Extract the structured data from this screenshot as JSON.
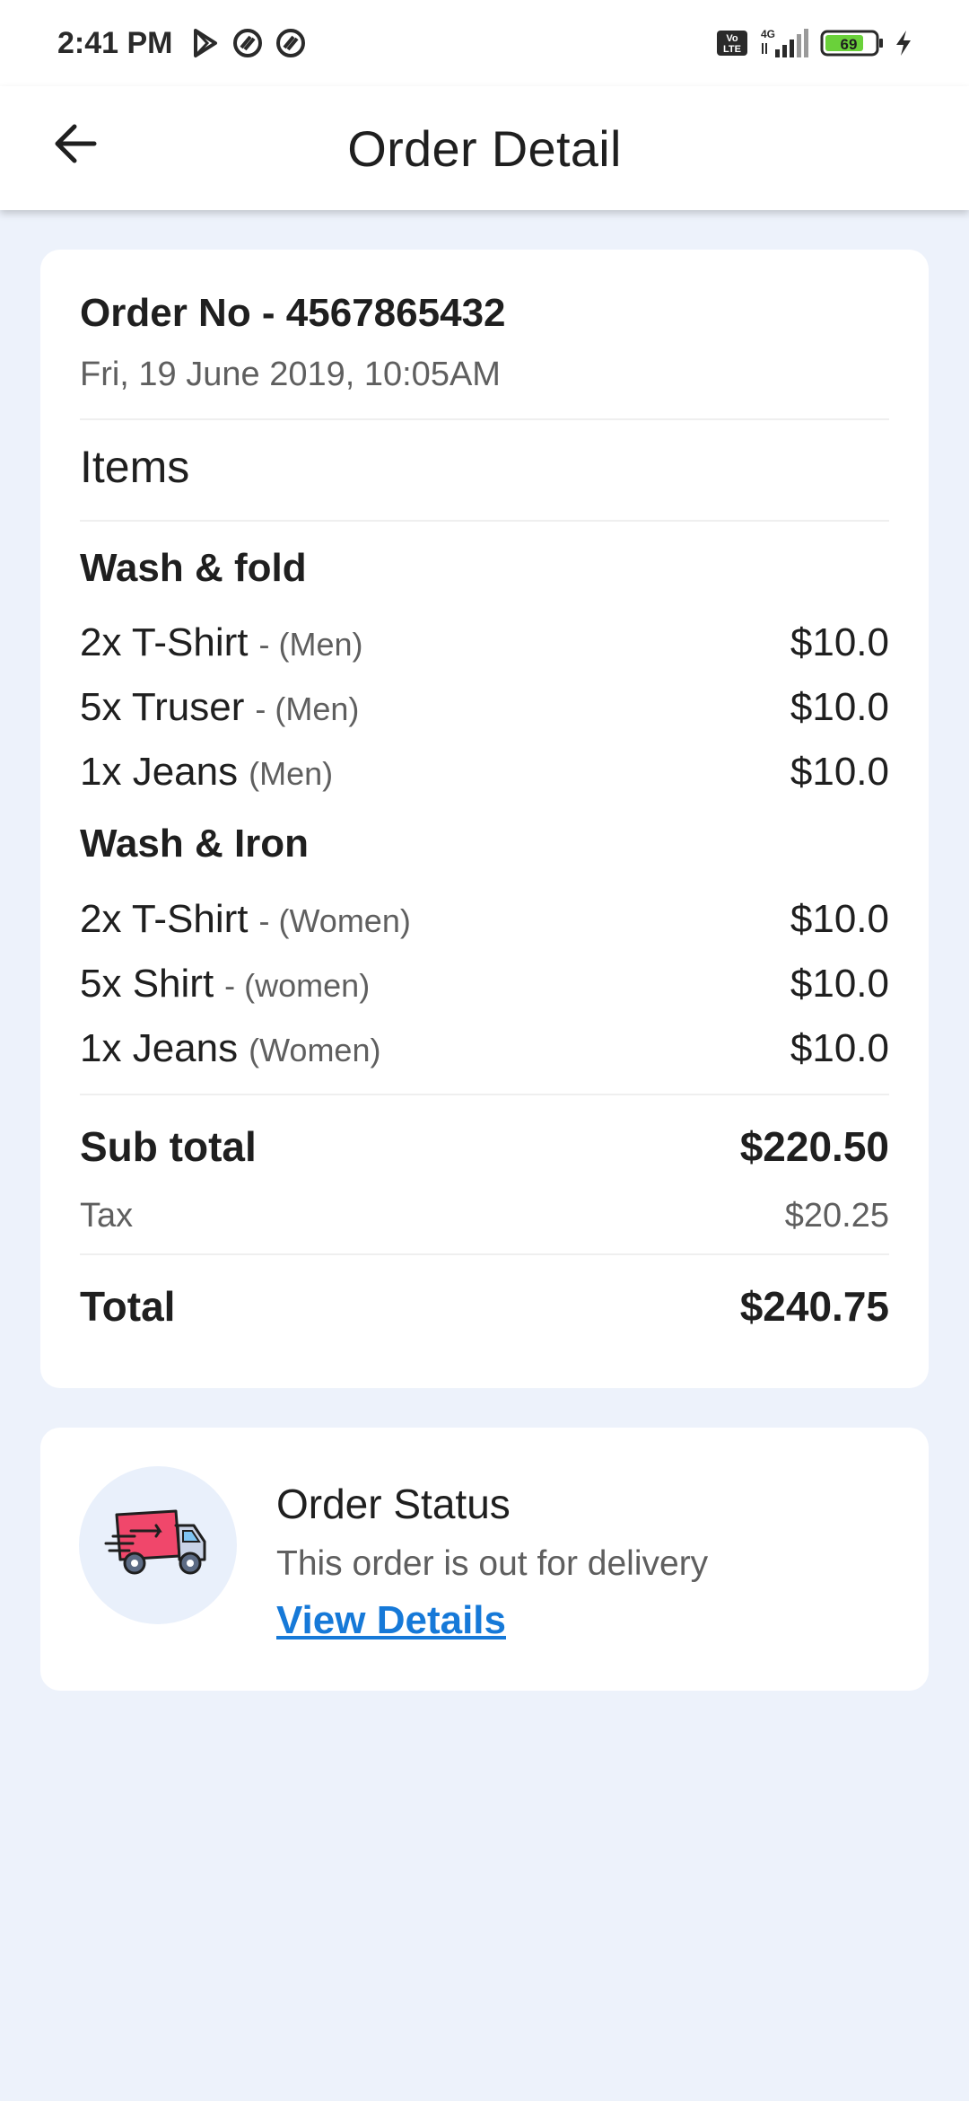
{
  "status_bar": {
    "time": "2:41 PM",
    "network": "4G",
    "volte": "Vo\nLTE",
    "battery": "69",
    "icons": [
      "play-store-icon",
      "notification-icon",
      "notification-icon",
      "volte-icon",
      "signal-icon",
      "battery-icon",
      "charging-icon"
    ]
  },
  "app_bar": {
    "title": "Order Detail",
    "back_icon": "arrow-left-icon"
  },
  "order": {
    "order_no": "Order No - 4567865432",
    "date": "Fri, 19 June 2019, 10:05AM",
    "items_heading": "Items",
    "groups": [
      {
        "title": "Wash & fold",
        "items": [
          {
            "name": "2x T-Shirt",
            "category": "- (Men)",
            "price": "$10.0"
          },
          {
            "name": "5x Truser",
            "category": "- (Men)",
            "price": "$10.0"
          },
          {
            "name": "1x Jeans",
            "category": "(Men)",
            "price": "$10.0"
          }
        ]
      },
      {
        "title": "Wash & Iron",
        "items": [
          {
            "name": "2x T-Shirt",
            "category": "- (Women)",
            "price": "$10.0"
          },
          {
            "name": "5x Shirt",
            "category": "- (women)",
            "price": "$10.0"
          },
          {
            "name": "1x Jeans",
            "category": "(Women)",
            "price": "$10.0"
          }
        ]
      }
    ],
    "subtotal_label": "Sub total",
    "subtotal_value": "$220.50",
    "tax_label": "Tax",
    "tax_value": "$20.25",
    "total_label": "Total",
    "total_value": "$240.75"
  },
  "status": {
    "icon": "delivery-truck-icon",
    "title": "Order Status",
    "description": "This order is out for delivery",
    "link_label": "View Details"
  },
  "colors": {
    "background": "#edf2fb",
    "card": "#ffffff",
    "link": "#1679d8",
    "truck_body": "#f0476b",
    "truck_circle": "#e9f0fb"
  }
}
